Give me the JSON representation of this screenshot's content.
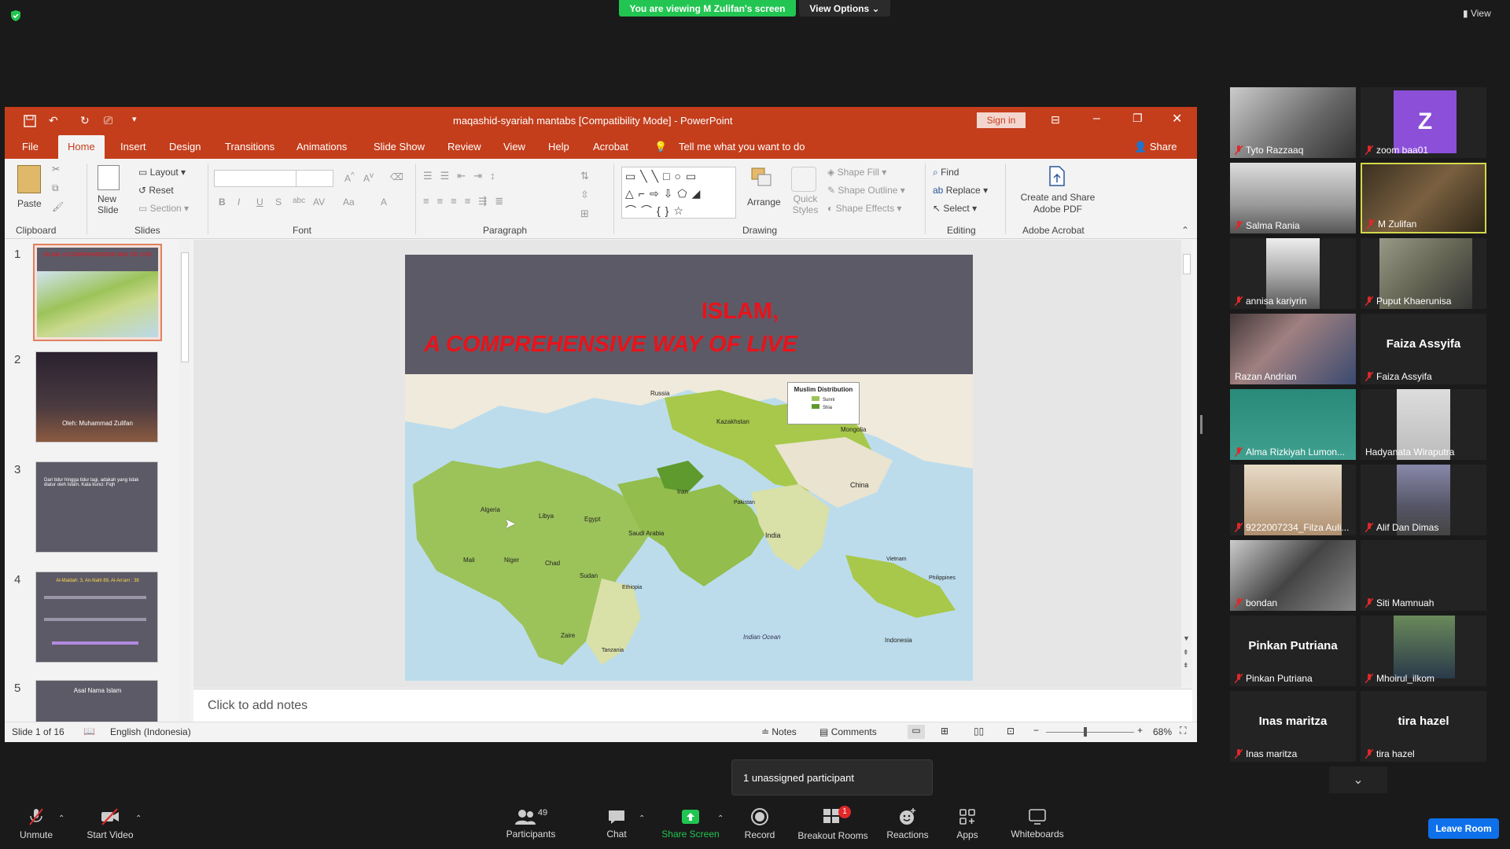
{
  "zoom": {
    "viewing_banner": "You are viewing M Zulifan's screen",
    "view_options": "View Options",
    "view_label": "View",
    "unassigned": "1 unassigned participant",
    "leave_room": "Leave Room"
  },
  "ppt": {
    "title": "maqashid-syariah mantabs [Compatibility Mode]  -  PowerPoint",
    "sign_in": "Sign in",
    "tabs": [
      "File",
      "Home",
      "Insert",
      "Design",
      "Transitions",
      "Animations",
      "Slide Show",
      "Review",
      "View",
      "Help",
      "Acrobat"
    ],
    "tell_me": "Tell me what you want to do",
    "share": "Share",
    "ribbon": {
      "clipboard": "Clipboard",
      "paste": "Paste",
      "slides": "Slides",
      "new_slide": "New Slide",
      "layout": "Layout",
      "reset": "Reset",
      "section": "Section",
      "font": "Font",
      "paragraph": "Paragraph",
      "drawing": "Drawing",
      "arrange": "Arrange",
      "quick_styles": "Quick Styles",
      "shape_fill": "Shape Fill",
      "shape_outline": "Shape Outline",
      "shape_effects": "Shape Effects",
      "editing": "Editing",
      "find": "Find",
      "replace": "Replace",
      "select": "Select",
      "adobe": "Adobe Acrobat",
      "create_share": "Create and Share Adobe PDF"
    },
    "slide": {
      "title_line1": "ISLAM,",
      "title_line2": "A COMPREHENSIVE WAY OF LIVE",
      "legend_title": "Muslim Distribution",
      "legend_items": [
        "Sunni",
        "Shia"
      ],
      "map_labels": [
        "Russia",
        "Kazakhstan",
        "Mongolia",
        "China",
        "India",
        "Iran",
        "Saudi Arabia",
        "Egypt",
        "Libya",
        "Algeria",
        "Mali",
        "Niger",
        "Chad",
        "Sudan",
        "Ethiopia",
        "Zaire",
        "Tanzania",
        "Indian Ocean",
        "Indonesia",
        "Vietnam",
        "Philippines",
        "Pakistan"
      ]
    },
    "thumbs": [
      {
        "num": "1",
        "caption": "ISLAM, A COMPREHENSIVE WAY OF LIVE"
      },
      {
        "num": "2",
        "caption": "Oleh: Muhammad Zulifan"
      },
      {
        "num": "3",
        "caption": "Dari tidur hingga tidur lagi, adakah yang tidak diatur oleh Islam. Kata kunci: Fiqh"
      },
      {
        "num": "4",
        "caption": "Al-Maidah: 3, An-Nahl 89, Al-An'am : 38"
      },
      {
        "num": "5",
        "caption": "Asal Nama Islam"
      }
    ],
    "notes_placeholder": "Click to add notes",
    "status": {
      "slide_of": "Slide 1 of 16",
      "language": "English (Indonesia)",
      "notes": "Notes",
      "comments": "Comments",
      "zoom": "68%"
    }
  },
  "participants": [
    {
      "name": "Tyto Razzaaq",
      "video": true
    },
    {
      "name": "zoom baa01",
      "avatar": "Z"
    },
    {
      "name": "Salma Rania",
      "video": true
    },
    {
      "name": "M Zulifan",
      "video": true,
      "active": true
    },
    {
      "name": "annisa kariyrin",
      "video": true
    },
    {
      "name": "Puput Khaerunisa",
      "video": true
    },
    {
      "name": "Razan Andrian",
      "video": true
    },
    {
      "name": "Faiza Assyifa",
      "big": "Faiza Assyifa"
    },
    {
      "name": "Alma Rizkiyah Lumon...",
      "video": true
    },
    {
      "name": "Hadyanata Wiraputra",
      "video": true
    },
    {
      "name": "9222007234_Filza Auli...",
      "video": true
    },
    {
      "name": "Alif Dan Dimas",
      "video": true
    },
    {
      "name": "bondan",
      "video": true
    },
    {
      "name": "Siti Mamnuah"
    },
    {
      "name": "Pinkan Putriana",
      "big": "Pinkan Putriana"
    },
    {
      "name": "Mhoirul_ilkom",
      "video": true
    },
    {
      "name": "Inas maritza",
      "big": "Inas maritza"
    },
    {
      "name": "tira hazel",
      "big": "tira hazel"
    }
  ],
  "toolbar": {
    "unmute": "Unmute",
    "start_video": "Start Video",
    "participants": "Participants",
    "participants_count": "49",
    "chat": "Chat",
    "share_screen": "Share Screen",
    "record": "Record",
    "breakout": "Breakout Rooms",
    "breakout_badge": "1",
    "reactions": "Reactions",
    "apps": "Apps",
    "whiteboards": "Whiteboards"
  },
  "colors": {
    "accent_green": "#23c552",
    "ppt_red": "#c43e1c",
    "leave_blue": "#0e71eb",
    "title_red": "#e8131b"
  }
}
